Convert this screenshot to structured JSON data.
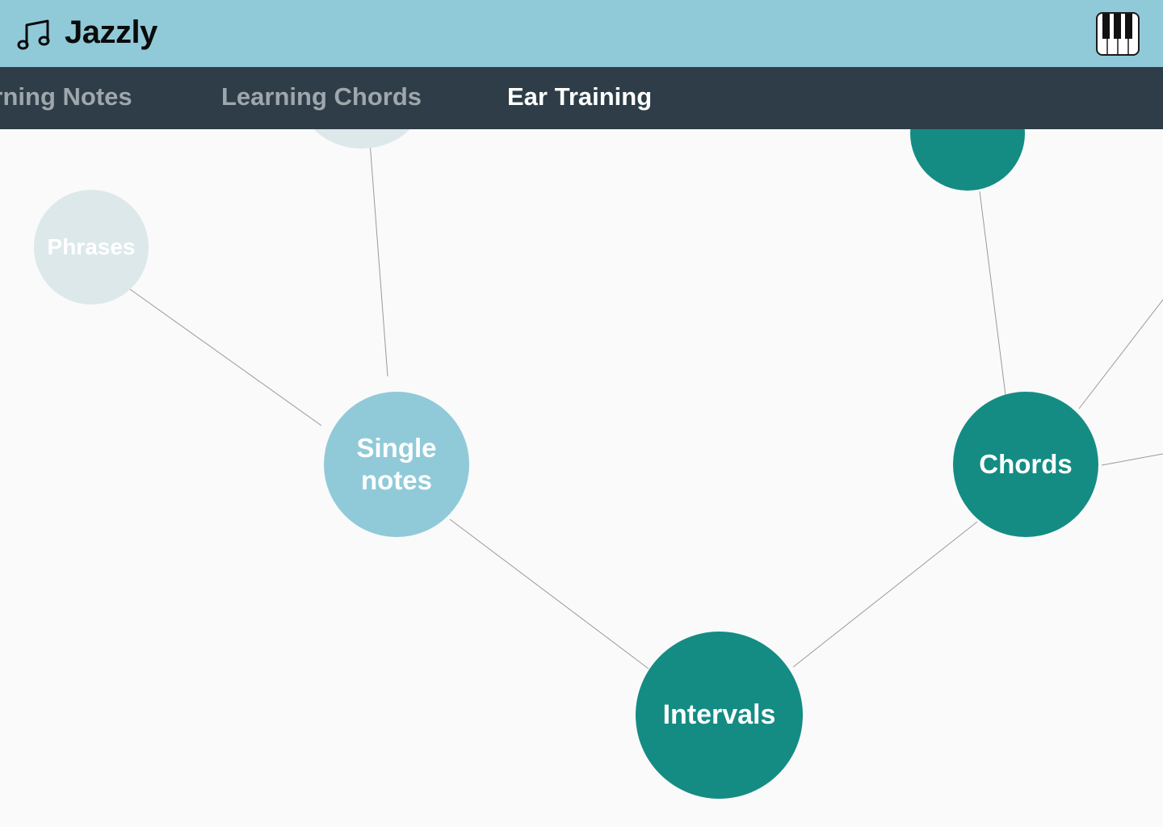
{
  "header": {
    "title": "Jazzly",
    "logo_icon": "music-notes-icon",
    "piano_icon": "piano-keys-icon",
    "background": "#90cad9"
  },
  "nav": {
    "tabs": [
      {
        "label": "Learning Notes",
        "active": false
      },
      {
        "label": "Learning Chords",
        "active": false
      },
      {
        "label": "Ear Training",
        "active": true
      }
    ],
    "background": "#2e3d47"
  },
  "graph": {
    "nodes": {
      "phrases": {
        "label": "Phrases",
        "state": "locked"
      },
      "single_notes": {
        "label_line1": "Single",
        "label_line2": "notes",
        "state": "unlocked"
      },
      "chords": {
        "label": "Chords",
        "state": "completed"
      },
      "intervals": {
        "label": "Intervals",
        "state": "completed"
      }
    },
    "colors": {
      "locked": "#dde8ea",
      "unlocked": "#90cad9",
      "completed": "#148c84",
      "edge": "#9a9a9a"
    }
  }
}
